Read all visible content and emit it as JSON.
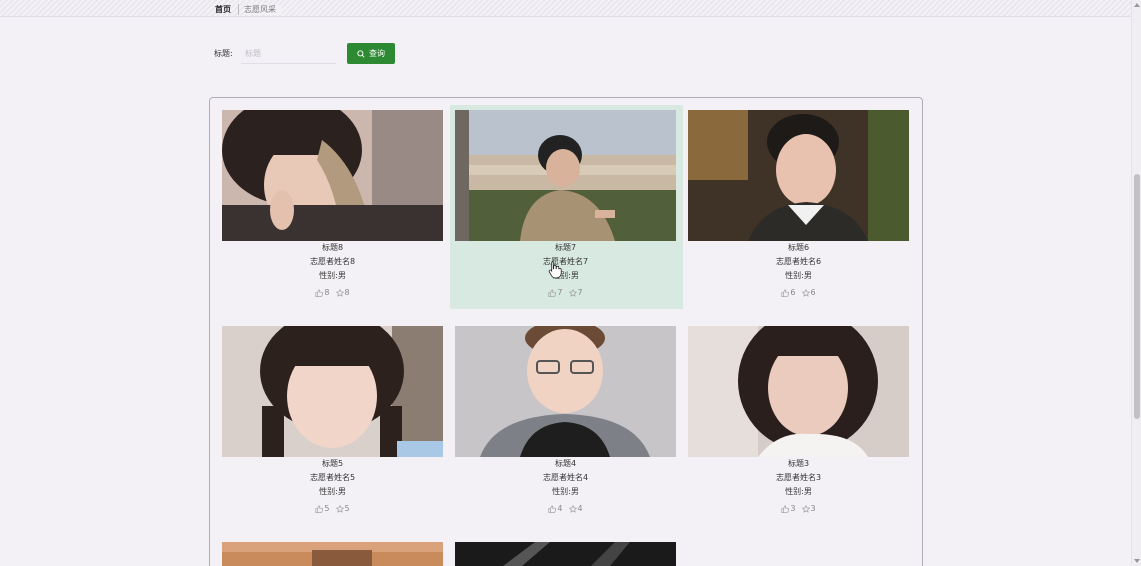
{
  "breadcrumb": {
    "home": "首页",
    "current": "志愿风采"
  },
  "search": {
    "label": "标题:",
    "placeholder": "标题",
    "value": "",
    "button_label": "查询",
    "button_icon": "search-icon"
  },
  "colors": {
    "accent": "#2d8a33",
    "active_card": "#d8e9e2"
  },
  "cards": [
    {
      "title": "标题8",
      "name": "志愿者姓名8",
      "gender": "性别:男",
      "likes": "8",
      "favorites": "8"
    },
    {
      "title": "标题7",
      "name": "志愿者姓名7",
      "gender": "性别:男",
      "likes": "7",
      "favorites": "7"
    },
    {
      "title": "标题6",
      "name": "志愿者姓名6",
      "gender": "性别:男",
      "likes": "6",
      "favorites": "6"
    },
    {
      "title": "标题5",
      "name": "志愿者姓名5",
      "gender": "性别:男",
      "likes": "5",
      "favorites": "5"
    },
    {
      "title": "标题4",
      "name": "志愿者姓名4",
      "gender": "性别:男",
      "likes": "4",
      "favorites": "4"
    },
    {
      "title": "标题3",
      "name": "志愿者姓名3",
      "gender": "性别:男",
      "likes": "3",
      "favorites": "3"
    }
  ]
}
